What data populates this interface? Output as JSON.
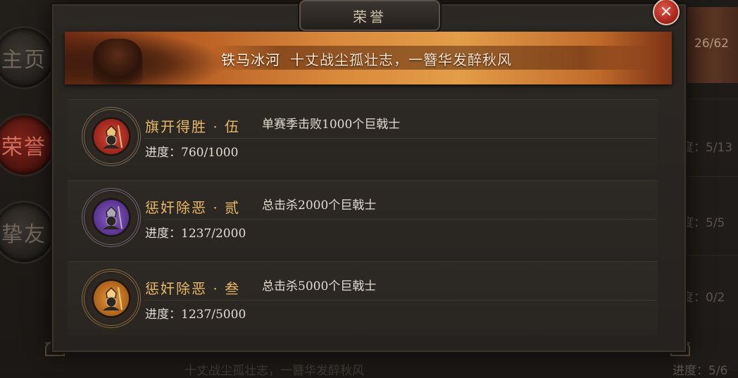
{
  "background": {
    "side_nav": [
      "主页",
      "荣誉",
      "挚友"
    ],
    "side_nav_active_index": 1,
    "right_banner_count": "26/62",
    "right_progress": [
      "度：5/13",
      "度：5/5",
      "度：0/2",
      "进度：5/6"
    ],
    "bottom_text": [
      "十丈战尘孤壮志，一簪华发醉秋风",
      "进度"
    ]
  },
  "modal": {
    "title": "荣誉",
    "close_icon": "✕",
    "banner": {
      "title": "铁马冰河",
      "subtitle": "十丈战尘孤壮志，一簪华发醉秋风"
    },
    "achievements": [
      {
        "name": "旗开得胜 · 伍",
        "description": "单赛季击败1000个巨戟士",
        "progress": "进度：760/1000",
        "badge_color": "#b3261e",
        "icon": "soldier-helmet-icon"
      },
      {
        "name": "惩奸除恶 · 贰",
        "description": "总击杀2000个巨戟士",
        "progress": "进度：1237/2000",
        "badge_color": "#6a3aa6",
        "icon": "soldier-helmet-icon"
      },
      {
        "name": "惩奸除恶 · 叁",
        "description": "总击杀5000个巨戟士",
        "progress": "进度：1237/5000",
        "badge_color": "#c9741e",
        "icon": "soldier-helmet-icon"
      }
    ]
  }
}
